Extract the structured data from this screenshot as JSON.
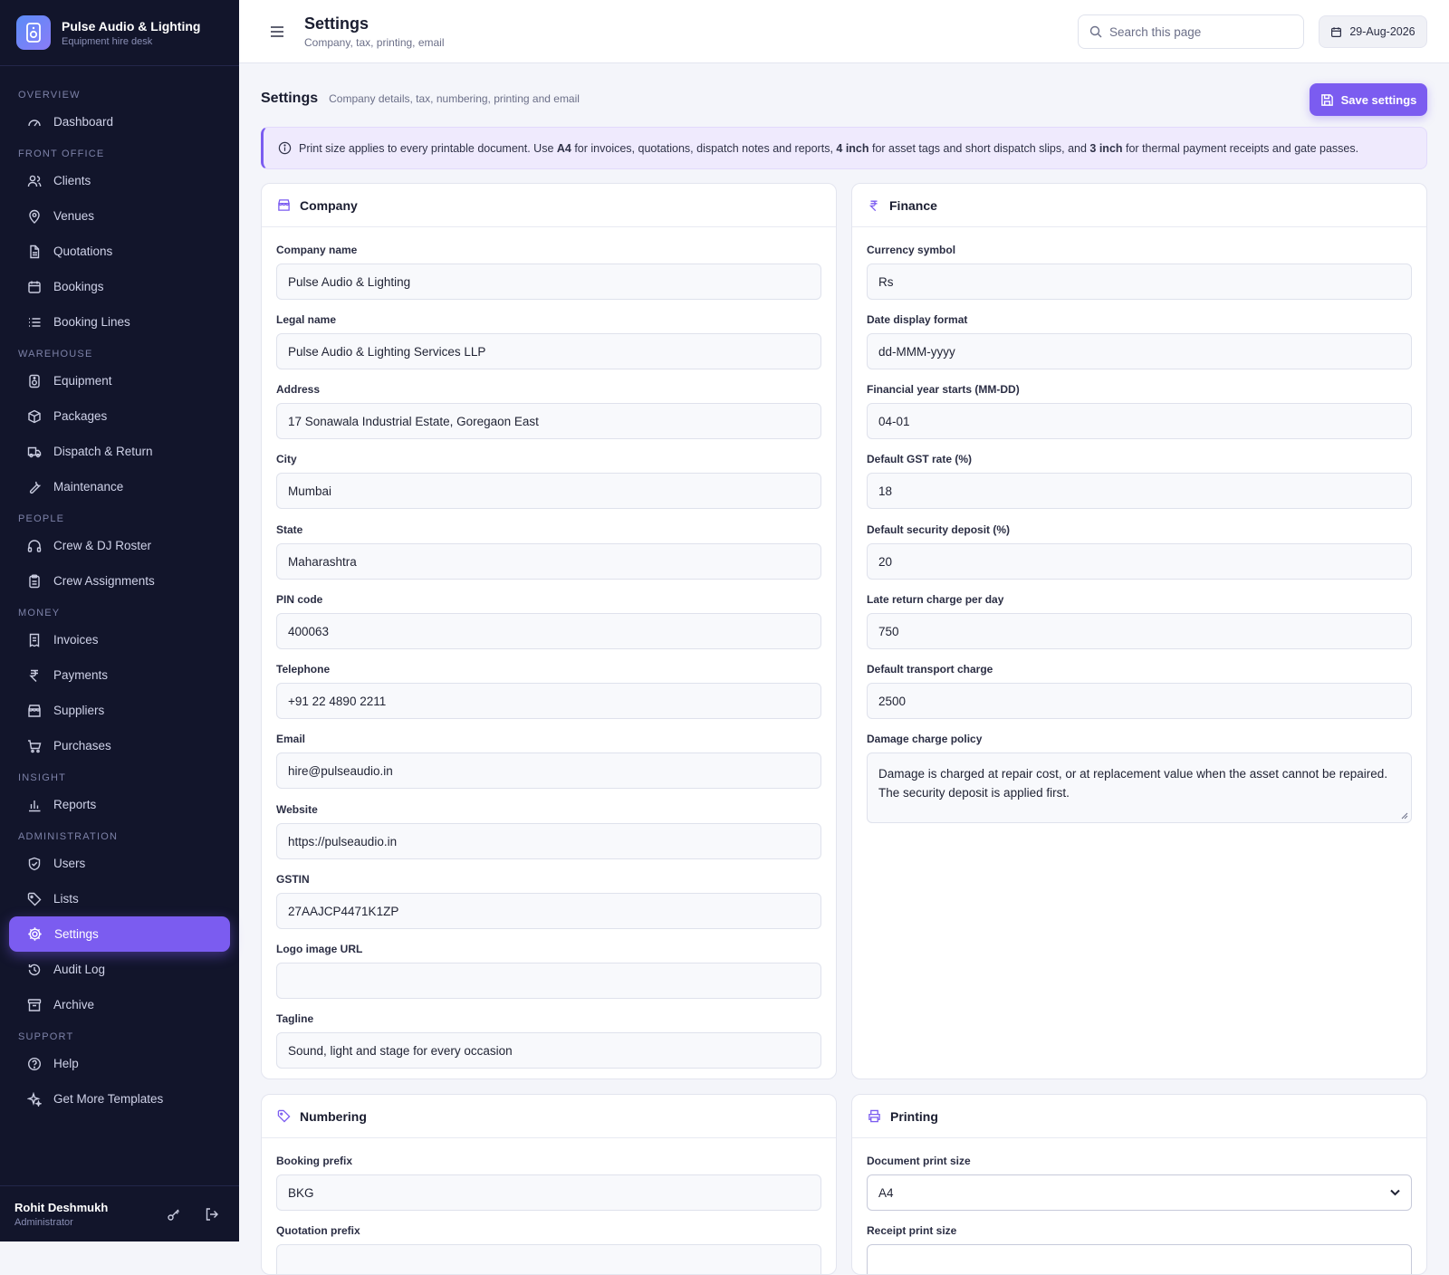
{
  "brand": {
    "title": "Pulse Audio & Lighting",
    "subtitle": "Equipment hire desk"
  },
  "nav": {
    "overview": "OVERVIEW",
    "dashboard": "Dashboard",
    "front_office": "FRONT OFFICE",
    "clients": "Clients",
    "venues": "Venues",
    "quotations": "Quotations",
    "bookings": "Bookings",
    "booking_lines": "Booking Lines",
    "warehouse": "WAREHOUSE",
    "equipment": "Equipment",
    "packages": "Packages",
    "dispatch": "Dispatch & Return",
    "maintenance": "Maintenance",
    "people": "PEOPLE",
    "crew": "Crew & DJ Roster",
    "crew_assign": "Crew Assignments",
    "money": "MONEY",
    "invoices": "Invoices",
    "payments": "Payments",
    "suppliers": "Suppliers",
    "purchases": "Purchases",
    "insight": "INSIGHT",
    "reports": "Reports",
    "administration": "ADMINISTRATION",
    "users": "Users",
    "lists": "Lists",
    "settings": "Settings",
    "audit": "Audit Log",
    "archive": "Archive",
    "support": "SUPPORT",
    "help": "Help",
    "templates": "Get More Templates"
  },
  "user": {
    "name": "Rohit Deshmukh",
    "role": "Administrator"
  },
  "topbar": {
    "title": "Settings",
    "subtitle": "Company, tax, printing, email",
    "search_placeholder": "Search this page",
    "date": "29-Aug-2026"
  },
  "page": {
    "title": "Settings",
    "subtitle": "Company details, tax, numbering, printing and email",
    "save_label": "Save settings"
  },
  "info": {
    "t1": "Print size applies to every printable document. Use ",
    "b1": "A4",
    "t2": " for invoices, quotations, dispatch notes and reports, ",
    "b2": "4 inch",
    "t3": " for asset tags and short dispatch slips, and ",
    "b3": "3 inch",
    "t4": " for thermal payment receipts and gate passes."
  },
  "company": {
    "title": "Company",
    "name_label": "Company name",
    "name": "Pulse Audio & Lighting",
    "legal_label": "Legal name",
    "legal": "Pulse Audio & Lighting Services LLP",
    "address_label": "Address",
    "address": "17 Sonawala Industrial Estate, Goregaon East",
    "city_label": "City",
    "city": "Mumbai",
    "state_label": "State",
    "state": "Maharashtra",
    "pin_label": "PIN code",
    "pin": "400063",
    "tel_label": "Telephone",
    "tel": "+91 22 4890 2211",
    "email_label": "Email",
    "email": "hire@pulseaudio.in",
    "web_label": "Website",
    "web": "https://pulseaudio.in",
    "gstin_label": "GSTIN",
    "gstin": "27AAJCP4471K1ZP",
    "logo_label": "Logo image URL",
    "logo": "",
    "tagline_label": "Tagline",
    "tagline": "Sound, light and stage for every occasion"
  },
  "finance": {
    "title": "Finance",
    "currency_label": "Currency symbol",
    "currency": "Rs",
    "date_label": "Date display format",
    "date_fmt": "dd-MMM-yyyy",
    "fy_label": "Financial year starts (MM-DD)",
    "fy": "04-01",
    "gst_label": "Default GST rate (%)",
    "gst": "18",
    "deposit_label": "Default security deposit (%)",
    "deposit": "20",
    "late_label": "Late return charge per day",
    "late": "750",
    "transport_label": "Default transport charge",
    "transport": "2500",
    "damage_label": "Damage charge policy",
    "damage": "Damage is charged at repair cost, or at replacement value when the asset cannot be repaired. The security deposit is applied first."
  },
  "numbering": {
    "title": "Numbering",
    "booking_label": "Booking prefix",
    "booking": "BKG",
    "quotation_label": "Quotation prefix"
  },
  "printing": {
    "title": "Printing",
    "doc_label": "Document print size",
    "doc": "A4",
    "receipt_label": "Receipt print size"
  },
  "colors": {
    "sidebar": "#12152b",
    "accent": "#7b5cf0"
  }
}
